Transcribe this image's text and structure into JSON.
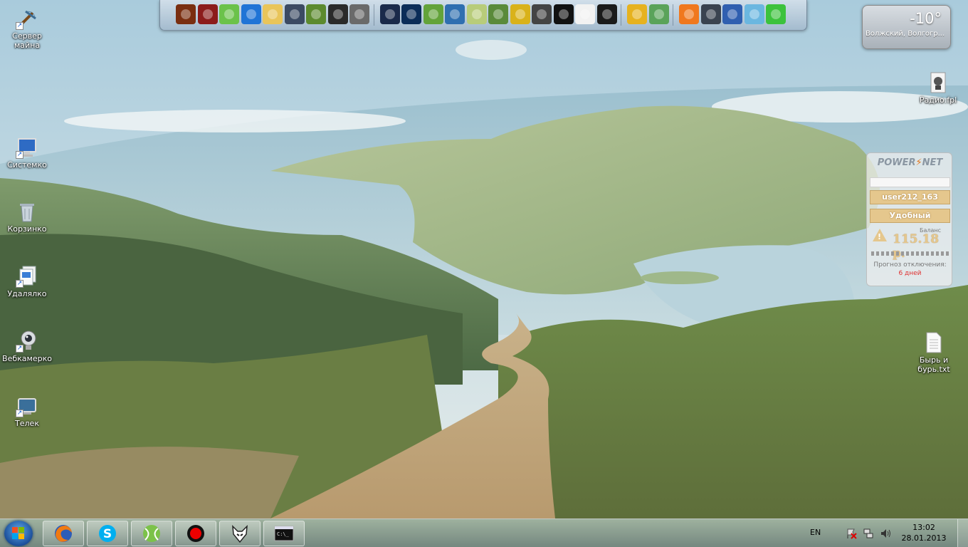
{
  "desktop": {
    "icons": [
      {
        "label": "Сервер майна"
      },
      {
        "label": "Системко"
      },
      {
        "label": "Корзинко"
      },
      {
        "label": "Удалялко"
      },
      {
        "label": "Вебкамерко"
      },
      {
        "label": "Телек"
      },
      {
        "label": "Радио.fpl"
      },
      {
        "label": "Бырь и бурь.txt"
      }
    ]
  },
  "dock": {
    "items": [
      {
        "icon": "diablo-icon",
        "color": "#7a2e10"
      },
      {
        "icon": "phone-app-icon",
        "color": "#8c1b1b"
      },
      {
        "icon": "sims-icon",
        "color": "#6bc24a"
      },
      {
        "icon": "pickaxe-icon",
        "color": "#1f74d6"
      },
      {
        "icon": "vault-boy-icon",
        "color": "#e9c55a"
      },
      {
        "icon": "soldier-icon",
        "color": "#3b4a63"
      },
      {
        "icon": "minecraft-block-icon",
        "color": "#5c8a2e"
      },
      {
        "icon": "star-compass-icon",
        "color": "#2a2a2a"
      },
      {
        "icon": "tank-shield-icon",
        "color": "#6a6a6a"
      },
      {
        "icon": "lens-app-icon",
        "color": "#1a2a4a"
      },
      {
        "icon": "photoshop-icon",
        "color": "#0b2d58"
      },
      {
        "icon": "landscape-app-icon",
        "color": "#63a33a"
      },
      {
        "icon": "pen-tool-icon",
        "color": "#2f6fb0"
      },
      {
        "icon": "notebook-icon",
        "color": "#b8cc7a"
      },
      {
        "icon": "road-icon",
        "color": "#5a8a3a"
      },
      {
        "icon": "winamp-icon",
        "color": "#d9b21a"
      },
      {
        "icon": "monitor-99-icon",
        "color": "#444444"
      },
      {
        "icon": "record-icon",
        "color": "#111111"
      },
      {
        "icon": "fox-mask-icon",
        "color": "#f2f2f2"
      },
      {
        "icon": "play-icon",
        "color": "#1a1a1a"
      },
      {
        "icon": "weather-sun-icon",
        "color": "#e6b21f"
      },
      {
        "icon": "money-icon",
        "color": "#5aa35a"
      },
      {
        "icon": "origin-icon",
        "color": "#f0781e"
      },
      {
        "icon": "steam-icon",
        "color": "#3a4350"
      },
      {
        "icon": "crescent-app-icon",
        "color": "#2f5fb0"
      },
      {
        "icon": "android-icon",
        "color": "#6bb7e0"
      },
      {
        "icon": "green-star-icon",
        "color": "#3cc23c"
      }
    ]
  },
  "weather": {
    "temperature": "-10°",
    "location": "Волжский, Волгогр..."
  },
  "powernet": {
    "logo_left": "POWER",
    "logo_bolt": "⚡",
    "logo_right": "NET",
    "username": "user212_163",
    "tariff": "Удобный",
    "balance_label": "Баланс",
    "balance": "115.18 р.",
    "warning_mark": "!",
    "forecast_label": "Прогноз отключения:",
    "forecast_value": "6 дней"
  },
  "taskbar": {
    "pinned": [
      {
        "icon": "firefox-icon"
      },
      {
        "icon": "skype-icon"
      },
      {
        "icon": "tennis-ball-icon"
      },
      {
        "icon": "record-icon"
      },
      {
        "icon": "fox-mask-icon"
      },
      {
        "icon": "console-icon"
      }
    ],
    "language": "EN",
    "time": "13:02",
    "date": "28.01.2013"
  },
  "colors": {
    "accent": "#1b4f9a",
    "powernet_field": "#e5c78d",
    "forecast_red": "#e03030"
  }
}
